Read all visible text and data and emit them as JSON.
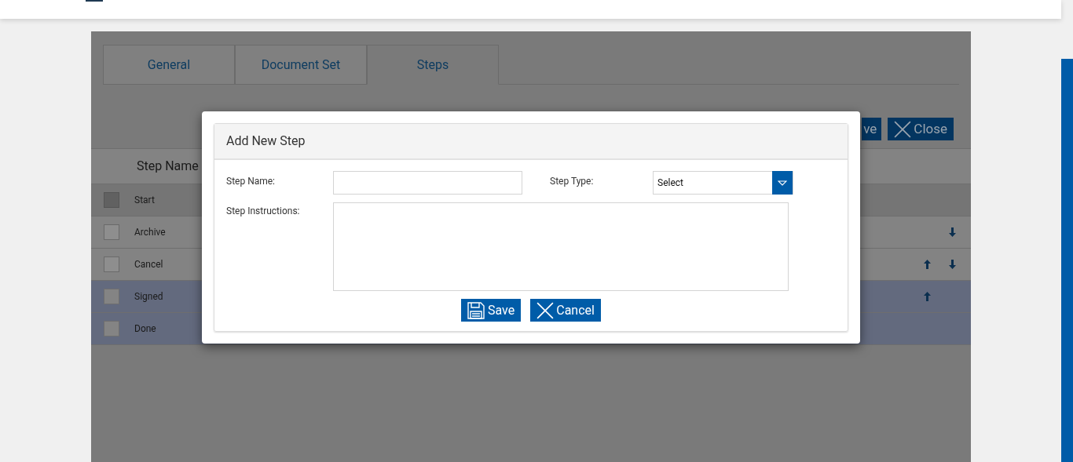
{
  "tabs": [
    {
      "label": "General",
      "selected": false
    },
    {
      "label": "Document Set",
      "selected": false
    },
    {
      "label": "Steps",
      "selected": true
    }
  ],
  "toolbar": {
    "save_label": "ve",
    "close_label": "Close"
  },
  "table": {
    "columns": [
      "Step Name"
    ],
    "rows": [
      {
        "name": "Start",
        "checked": false,
        "disabled": true,
        "selected": false,
        "can_move_up": false,
        "can_move_down": false
      },
      {
        "name": "Archive",
        "checked": false,
        "disabled": false,
        "selected": false,
        "can_move_up": false,
        "can_move_down": true
      },
      {
        "name": "Cancel",
        "checked": false,
        "disabled": false,
        "selected": false,
        "can_move_up": true,
        "can_move_down": true
      },
      {
        "name": "Signed",
        "checked": false,
        "disabled": false,
        "selected": true,
        "can_move_up": true,
        "can_move_down": false
      },
      {
        "name": "Done",
        "checked": false,
        "disabled": false,
        "selected": true,
        "can_move_up": false,
        "can_move_down": false
      }
    ]
  },
  "dialog": {
    "title": "Add New Step",
    "step_name_label": "Step Name:",
    "step_type_label": "Step Type:",
    "step_type_value": "Select",
    "instructions_label": "Step Instructions:",
    "save_label": "Save",
    "cancel_label": "Cancel"
  }
}
